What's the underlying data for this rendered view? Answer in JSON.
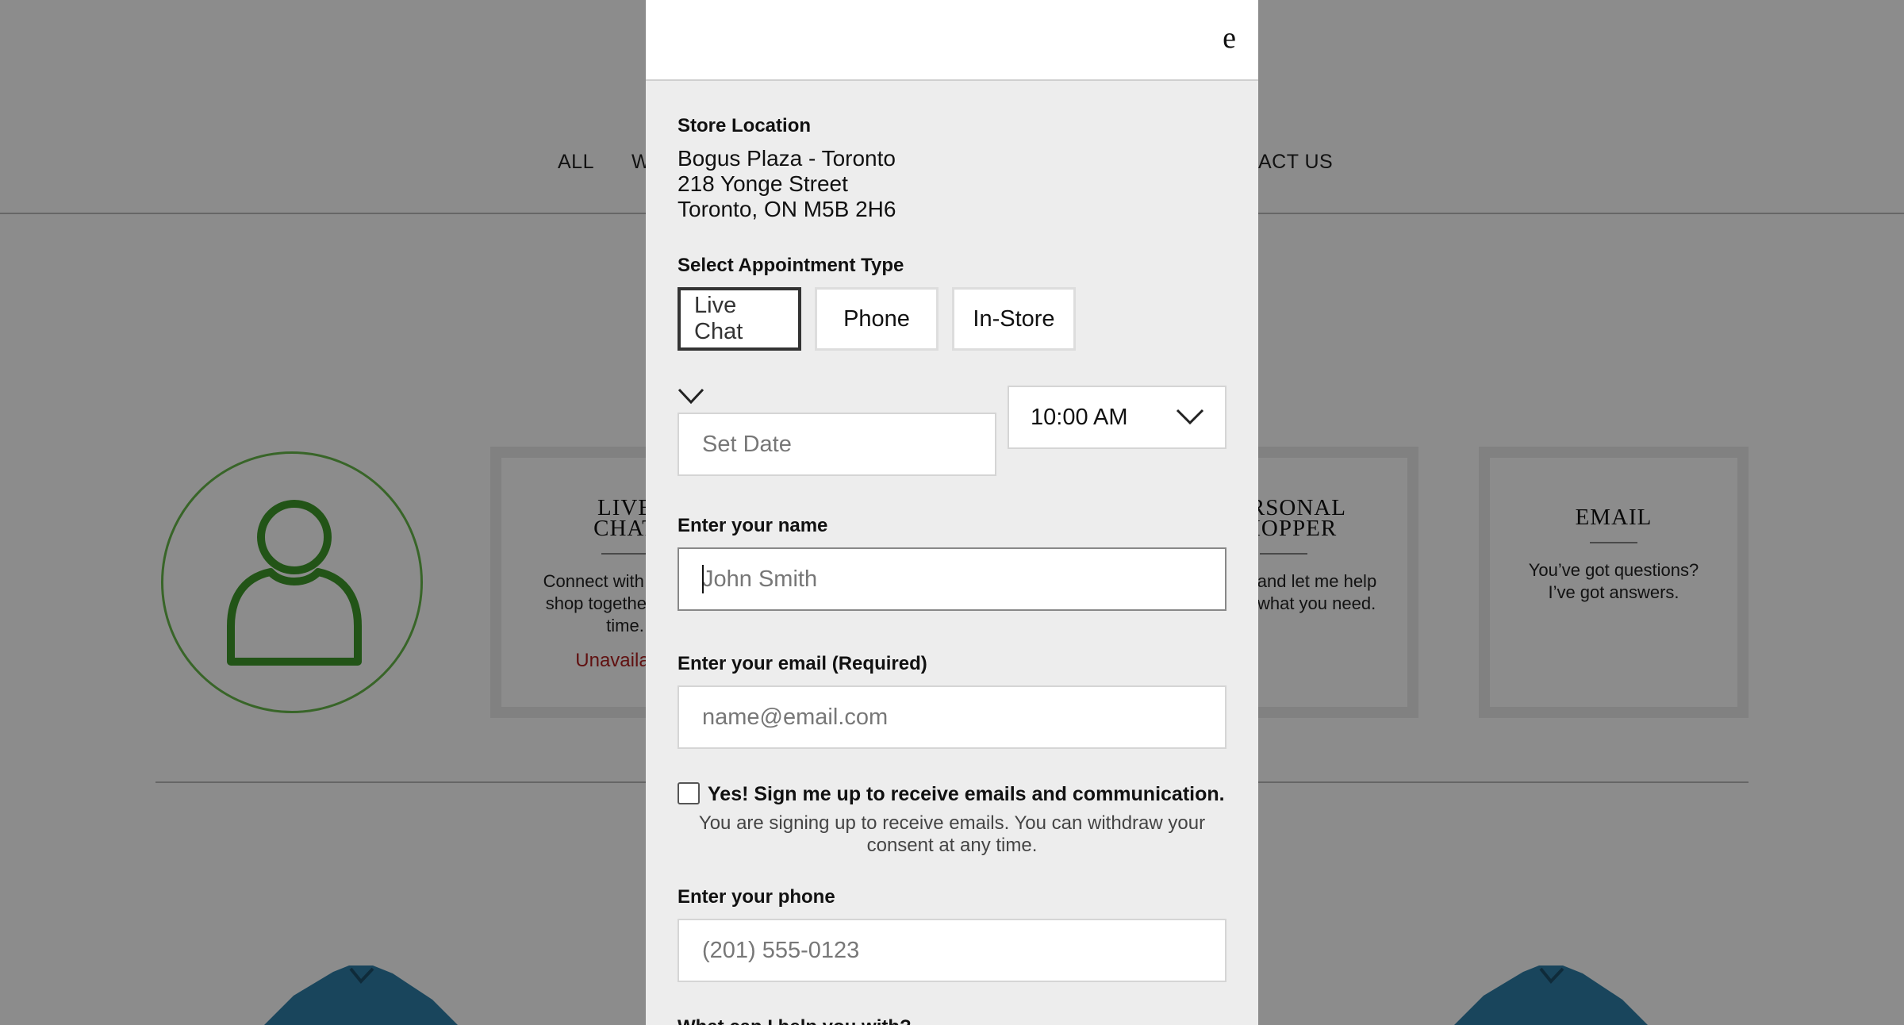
{
  "background": {
    "nav": {
      "item_all": "ALL",
      "item_w": "W",
      "item_contact": "ACT US"
    },
    "cards": {
      "live_chat": {
        "title_line1": "LIVE",
        "title_line2": "CHAT",
        "text": "Connect with me and shop together in real time.",
        "status": "Unavailable"
      },
      "personal_shopper": {
        "title_line1": "PERSONAL",
        "title_line2": "SHOPPER",
        "text": "Visit me and let me help you find what you need."
      },
      "email": {
        "title": "EMAIL",
        "text": "You’ve got questions? I’ve got answers."
      }
    },
    "colors": {
      "avatar_green": "#66b84a",
      "unavailable_red": "#b02020",
      "product_blue": "#2f7fa8"
    }
  },
  "modal": {
    "close_icon_glyph": "e",
    "store_location_label": "Store Location",
    "address_line1": "Bogus Plaza - Toronto",
    "address_line2": "218 Yonge Street",
    "address_line3": "Toronto, ON M5B 2H6",
    "appointment_type_label": "Select Appointment Type",
    "appointment_types": [
      "Live Chat",
      "Phone",
      "In-Store"
    ],
    "selected_type": "Live Chat",
    "date_placeholder": "Set Date",
    "time_value": "10:00 AM",
    "name_label": "Enter your name",
    "name_placeholder": "John Smith",
    "email_label": "Enter your email (Required)",
    "email_placeholder": "name@email.com",
    "signup_label": "Yes! Sign me up to receive emails and communication.",
    "signup_checked": false,
    "consent_text": "You are signing up to receive emails. You can withdraw your consent at any time.",
    "phone_label": "Enter your phone",
    "phone_placeholder": "(201) 555-0123",
    "help_label": "What can I help you with?"
  }
}
